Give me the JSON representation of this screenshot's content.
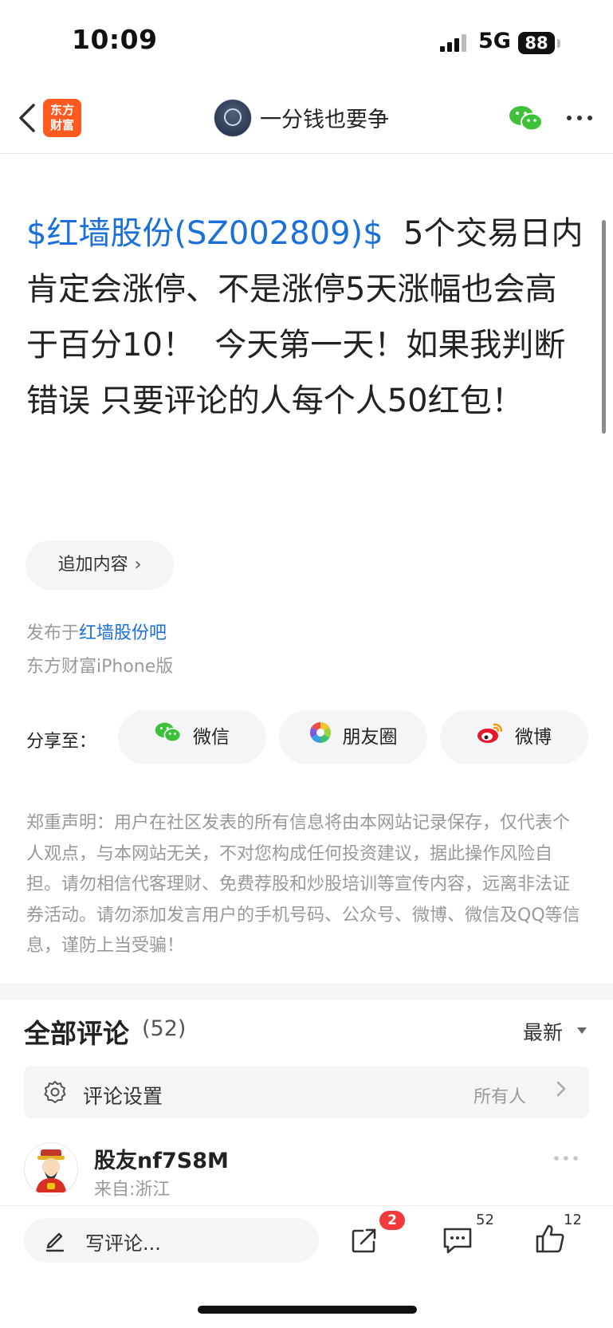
{
  "status_bar": {
    "time": "10:09",
    "network": "5G",
    "battery": "88"
  },
  "nav": {
    "back_icon": "chevron-left-icon",
    "logo_line1": "东方",
    "logo_line2": "财富",
    "title": "一分钱也要争"
  },
  "post": {
    "stock_tag": "$红墙股份(SZ002809)$",
    "content": "  5个交易日内肯定会涨停、不是涨停5天涨幅也会高于百分10！  今天第一天！如果我判断错误 只要评论的人每个人50红包！",
    "append_label": "追加内容",
    "published_prefix": "发布于",
    "published_bar": "红墙股份吧",
    "client": "东方财富iPhone版"
  },
  "share": {
    "label": "分享至：",
    "wechat": "微信",
    "moments": "朋友圈",
    "weibo": "微博"
  },
  "disclaimer": "郑重声明：用户在社区发表的所有信息将由本网站记录保存，仅代表个人观点，与本网站无关，不对您构成任何投资建议，据此操作风险自担。请勿相信代客理财、免费荐股和炒股培训等宣传内容，远离非法证券活动。请勿添加发言用户的手机号码、公众号、微博、微信及QQ等信息，谨防上当受骗！",
  "comments": {
    "title": "全部评论",
    "count": "(52)",
    "sort": "最新",
    "settings_label": "评论设置",
    "settings_value": "所有人",
    "items": [
      {
        "name": "股友nf7S8M",
        "location": "来自:浙江"
      }
    ]
  },
  "bottom_bar": {
    "placeholder": "写评论...",
    "share_badge": "2",
    "comment_count": "52",
    "like_count": "12"
  },
  "colors": {
    "link": "#1a6fd8",
    "brand": "#ff5a1f",
    "badge": "#f23a3a"
  }
}
